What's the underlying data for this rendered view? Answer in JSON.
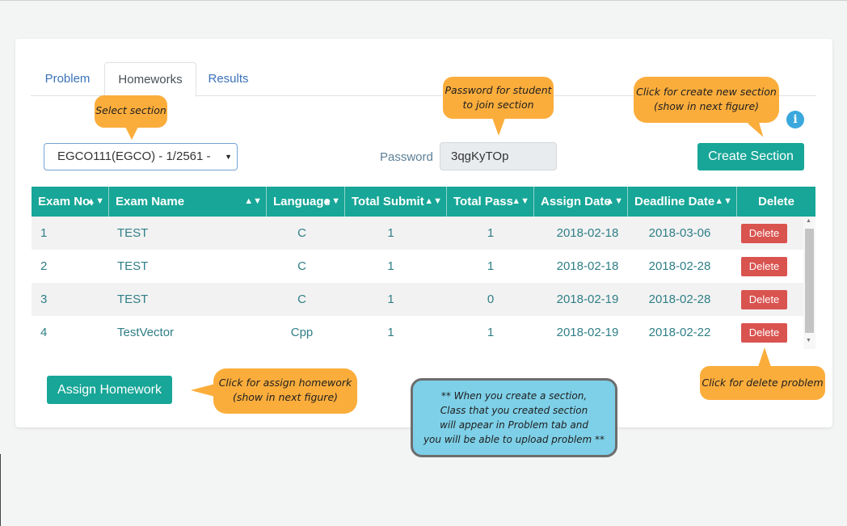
{
  "tabs": [
    {
      "label": "Problem",
      "active": false
    },
    {
      "label": "Homeworks",
      "active": true
    },
    {
      "label": "Results",
      "active": false
    }
  ],
  "section_select": {
    "value": "EGCO111(EGCO) - 1/2561 -"
  },
  "password": {
    "label": "Password",
    "value": "3qgKyTOp"
  },
  "create_section_label": "Create Section",
  "assign_homework_label": "Assign Homework",
  "table": {
    "headers": [
      "Exam No.",
      "Exam Name",
      "Language",
      "Total Submit",
      "Total Pass",
      "Assign Date",
      "Deadline Date",
      "Delete"
    ],
    "rows": [
      {
        "no": "1",
        "name": "TEST",
        "language": "C",
        "submit": "1",
        "pass": "1",
        "assign": "2018-02-18",
        "deadline": "2018-03-06",
        "delete": "Delete"
      },
      {
        "no": "2",
        "name": "TEST",
        "language": "C",
        "submit": "1",
        "pass": "1",
        "assign": "2018-02-18",
        "deadline": "2018-02-28",
        "delete": "Delete"
      },
      {
        "no": "3",
        "name": "TEST",
        "language": "C",
        "submit": "1",
        "pass": "0",
        "assign": "2018-02-19",
        "deadline": "2018-02-28",
        "delete": "Delete"
      },
      {
        "no": "4",
        "name": "TestVector",
        "language": "Cpp",
        "submit": "1",
        "pass": "1",
        "assign": "2018-02-19",
        "deadline": "2018-02-22",
        "delete": "Delete"
      }
    ]
  },
  "annotations": {
    "select_section": "Select section",
    "password_l1": "Password for student",
    "password_l2": "to join section",
    "create_l1": "Click for create new section",
    "create_l2": "(show in next figure)",
    "assign_l1": "Click for assign homework",
    "assign_l2": "(show in next figure)",
    "delete": "Click for delete problem",
    "note_l1": "** When you create a section,",
    "note_l2": "Class that you created section",
    "note_l3": "will appear in Problem tab and",
    "note_l4": "you will be able to upload problem **"
  },
  "colors": {
    "teal": "#17a697",
    "danger": "#d9534f",
    "callout": "#fbad3c",
    "note": "#7ed0e8"
  }
}
